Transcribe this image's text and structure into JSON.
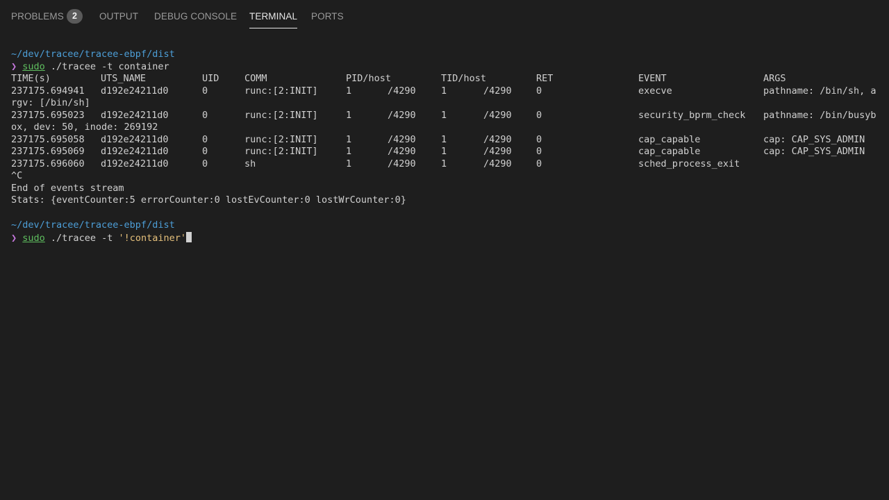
{
  "panel": {
    "tabs": [
      {
        "label": "PROBLEMS",
        "badge": "2"
      },
      {
        "label": "OUTPUT"
      },
      {
        "label": "DEBUG CONSOLE"
      },
      {
        "label": "TERMINAL",
        "active": true
      },
      {
        "label": "PORTS"
      }
    ]
  },
  "terminal": {
    "block1": {
      "path": "~/dev/tracee/tracee-ebpf/dist",
      "arrow": "❯",
      "sudo": "sudo",
      "command": " ./tracee -t container"
    },
    "table": {
      "headers": [
        "TIME(s)",
        "UTS_NAME",
        "UID",
        "COMM",
        "PID/host",
        "TID/host",
        "RET",
        "EVENT",
        "ARGS"
      ],
      "rows": [
        {
          "time": "237175.694941",
          "uts": "d192e24211d0",
          "uid": "0",
          "comm": "runc:[2:INIT]",
          "pid": "1",
          "pidhost": "/4290",
          "tid": "1",
          "tidhost": "/4290",
          "ret": "0",
          "event": "execve",
          "args": "pathname: /bin/sh, a",
          "wrap": "rgv: [/bin/sh]"
        },
        {
          "time": "237175.695023",
          "uts": "d192e24211d0",
          "uid": "0",
          "comm": "runc:[2:INIT]",
          "pid": "1",
          "pidhost": "/4290",
          "tid": "1",
          "tidhost": "/4290",
          "ret": "0",
          "event": "security_bprm_check",
          "args": "pathname: /bin/busyb",
          "wrap": "ox, dev: 50, inode: 269192"
        },
        {
          "time": "237175.695058",
          "uts": "d192e24211d0",
          "uid": "0",
          "comm": "runc:[2:INIT]",
          "pid": "1",
          "pidhost": "/4290",
          "tid": "1",
          "tidhost": "/4290",
          "ret": "0",
          "event": "cap_capable",
          "args": "cap: CAP_SYS_ADMIN"
        },
        {
          "time": "237175.695069",
          "uts": "d192e24211d0",
          "uid": "0",
          "comm": "runc:[2:INIT]",
          "pid": "1",
          "pidhost": "/4290",
          "tid": "1",
          "tidhost": "/4290",
          "ret": "0",
          "event": "cap_capable",
          "args": "cap: CAP_SYS_ADMIN"
        },
        {
          "time": "237175.696060",
          "uts": "d192e24211d0",
          "uid": "0",
          "comm": "sh",
          "pid": "1",
          "pidhost": "/4290",
          "tid": "1",
          "tidhost": "/4290",
          "ret": "0",
          "event": "sched_process_exit",
          "args": ""
        }
      ]
    },
    "interrupt": "^C",
    "end_message": "End of events stream",
    "stats": "Stats: {eventCounter:5 errorCounter:0 lostEvCounter:0 lostWrCounter:0}",
    "block2": {
      "path": "~/dev/tracee/tracee-ebpf/dist",
      "arrow": "❯",
      "sudo": "sudo",
      "command": " ./tracee -t ",
      "quoted": "'!container'"
    }
  }
}
